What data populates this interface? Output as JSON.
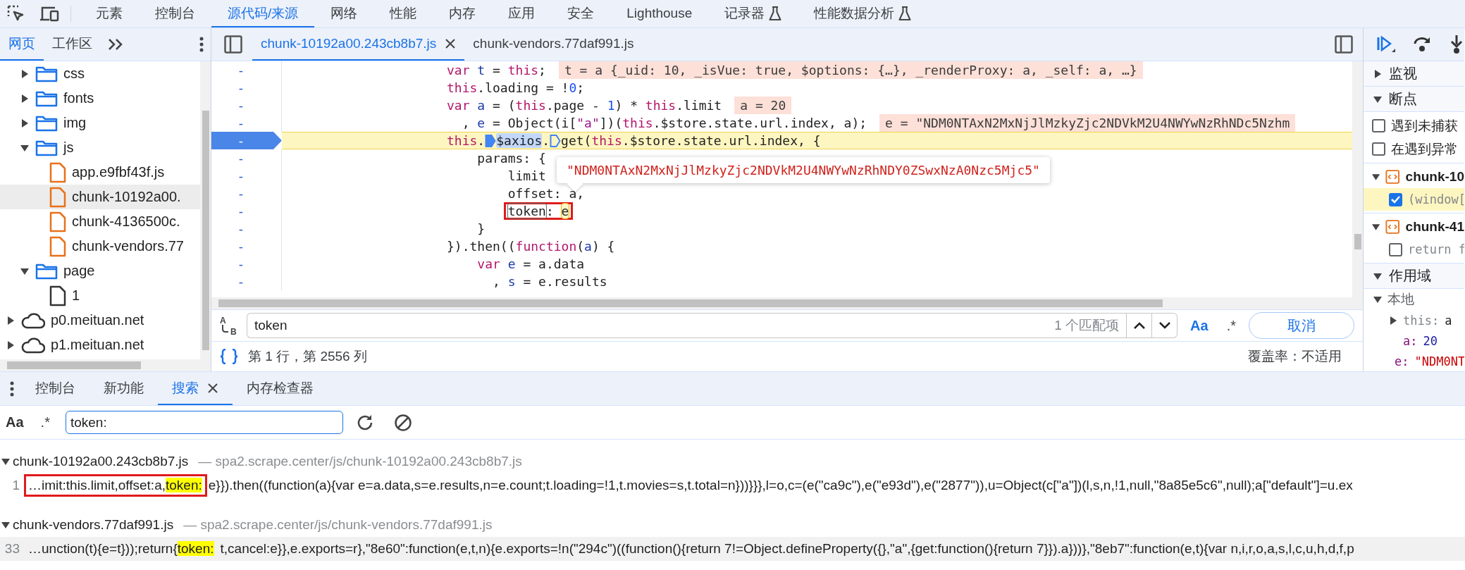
{
  "main_tabs": [
    {
      "label": "元素",
      "selected": false,
      "experimental": false
    },
    {
      "label": "控制台",
      "selected": false,
      "experimental": false
    },
    {
      "label": "源代码/来源",
      "selected": true,
      "experimental": false
    },
    {
      "label": "网络",
      "selected": false,
      "experimental": false
    },
    {
      "label": "性能",
      "selected": false,
      "experimental": false
    },
    {
      "label": "内存",
      "selected": false,
      "experimental": false
    },
    {
      "label": "应用",
      "selected": false,
      "experimental": false
    },
    {
      "label": "安全",
      "selected": false,
      "experimental": false
    },
    {
      "label": "Lighthouse",
      "selected": false,
      "experimental": false
    },
    {
      "label": "记录器",
      "selected": false,
      "experimental": true
    },
    {
      "label": "性能数据分析",
      "selected": false,
      "experimental": true
    }
  ],
  "navigator": {
    "tabs": [
      {
        "label": "网页",
        "selected": true
      },
      {
        "label": "工作区",
        "selected": false
      }
    ],
    "tree": {
      "nested": [
        {
          "label": "css",
          "kind": "folder",
          "expanded": false,
          "selected": false
        },
        {
          "label": "fonts",
          "kind": "folder",
          "expanded": false,
          "selected": false
        },
        {
          "label": "img",
          "kind": "folder",
          "expanded": false,
          "selected": false
        },
        {
          "label": "js",
          "kind": "folder",
          "expanded": true,
          "selected": false,
          "children": [
            {
              "label": "app.e9fbf43f.js",
              "kind": "script",
              "selected": false
            },
            {
              "label": "chunk-10192a00.",
              "kind": "script",
              "selected": true
            },
            {
              "label": "chunk-4136500c.",
              "kind": "script",
              "selected": false
            },
            {
              "label": "chunk-vendors.77",
              "kind": "script",
              "selected": false
            }
          ]
        },
        {
          "label": "page",
          "kind": "folder",
          "expanded": true,
          "selected": false,
          "children": [
            {
              "label": "1",
              "kind": "document",
              "selected": false
            }
          ]
        }
      ],
      "roots": [
        {
          "label": "p0.meituan.net",
          "kind": "domain",
          "expanded": false,
          "selected": false
        },
        {
          "label": "p1.meituan.net",
          "kind": "domain",
          "expanded": false,
          "selected": false
        }
      ]
    }
  },
  "editor": {
    "tabs": [
      {
        "label": "chunk-10192a00.243cb8b7.js",
        "selected": true,
        "closable": true
      },
      {
        "label": "chunk-vendors.77daf991.js",
        "selected": false,
        "closable": false
      }
    ],
    "lines": [
      {
        "gutter": "-",
        "current": false,
        "tokens": [
          {
            "kind": "kw",
            "text": "var"
          },
          {
            "kind": "def",
            "text": " t"
          },
          {
            "kind": "plain",
            "text": " = "
          },
          {
            "kind": "kw",
            "text": "this"
          },
          {
            "kind": "plain",
            "text": ";"
          },
          {
            "kind": "inline",
            "text": "t = a {_uid: 10, _isVue: true, $options: {…}, _renderProxy: a, _self: a, …}"
          }
        ]
      },
      {
        "gutter": "-",
        "current": false,
        "tokens": [
          {
            "kind": "kw",
            "text": "this"
          },
          {
            "kind": "plain",
            "text": ".loading = !"
          },
          {
            "kind": "num",
            "text": "0"
          },
          {
            "kind": "plain",
            "text": ";"
          }
        ]
      },
      {
        "gutter": "-",
        "current": false,
        "tokens": [
          {
            "kind": "kw",
            "text": "var"
          },
          {
            "kind": "def",
            "text": " a"
          },
          {
            "kind": "plain",
            "text": " = ("
          },
          {
            "kind": "kw",
            "text": "this"
          },
          {
            "kind": "plain",
            "text": ".page - "
          },
          {
            "kind": "num",
            "text": "1"
          },
          {
            "kind": "plain",
            "text": ") * "
          },
          {
            "kind": "kw",
            "text": "this"
          },
          {
            "kind": "plain",
            "text": ".limit"
          },
          {
            "kind": "inline",
            "text": "a = 20"
          }
        ]
      },
      {
        "gutter": "-",
        "current": false,
        "tokens": [
          {
            "kind": "plain",
            "text": "  , "
          },
          {
            "kind": "def",
            "text": "e"
          },
          {
            "kind": "plain",
            "text": " = Object(i["
          },
          {
            "kind": "str",
            "text": "\"a\""
          },
          {
            "kind": "plain",
            "text": "])("
          },
          {
            "kind": "kw",
            "text": "this"
          },
          {
            "kind": "plain",
            "text": ".$store.state.url.index, a);"
          },
          {
            "kind": "inline",
            "text": "e = \"NDM0NTAxN2MxNjJlMzkyZjc2NDVkM2U4NWYwNzRhNDc5Nzhm"
          }
        ]
      },
      {
        "gutter": "-",
        "current": true,
        "tokens": [
          {
            "kind": "kw",
            "text": "this"
          },
          {
            "kind": "plain",
            "text": "."
          },
          {
            "kind": "bp",
            "on": true
          },
          {
            "kind": "sel",
            "text": "$axios"
          },
          {
            "kind": "plain",
            "text": "."
          },
          {
            "kind": "bp",
            "on": false
          },
          {
            "kind": "plain",
            "text": "get("
          },
          {
            "kind": "kw",
            "text": "this"
          },
          {
            "kind": "plain",
            "text": ".$store.state.url.index, {"
          }
        ],
        "children": [
          {
            "gutter": "-",
            "current": false,
            "tokens": [
              {
                "kind": "plain",
                "text": "params: {"
              }
            ],
            "children": [
              {
                "gutter": "-",
                "current": false,
                "tokens": [
                  {
                    "kind": "plain",
                    "text": "limit"
                  }
                ]
              },
              {
                "gutter": "-",
                "current": false,
                "tokens": [
                  {
                    "kind": "plain",
                    "text": "offset: a,"
                  }
                ]
              },
              {
                "gutter": "-",
                "current": false,
                "tokens": [
                  {
                    "kind": "match",
                    "text": "token",
                    "annotated": true
                  },
                  {
                    "kind": "plain",
                    "text": ": ",
                    "annotated": true
                  },
                  {
                    "kind": "cursor",
                    "text": "e",
                    "annotated": true
                  }
                ]
              }
            ]
          },
          {
            "gutter": "-",
            "current": false,
            "tokens": [
              {
                "kind": "plain",
                "text": "}"
              }
            ]
          }
        ]
      },
      {
        "gutter": "-",
        "current": false,
        "tokens": [
          {
            "kind": "plain",
            "text": "}).then(("
          },
          {
            "kind": "kw",
            "text": "function"
          },
          {
            "kind": "plain",
            "text": "("
          },
          {
            "kind": "def",
            "text": "a"
          },
          {
            "kind": "plain",
            "text": ") {"
          }
        ],
        "children": [
          {
            "gutter": "-",
            "current": false,
            "tokens": [
              {
                "kind": "kw",
                "text": "var"
              },
              {
                "kind": "def",
                "text": " e"
              },
              {
                "kind": "plain",
                "text": " = a.data"
              }
            ]
          },
          {
            "gutter": "-",
            "current": false,
            "tokens": [
              {
                "kind": "plain",
                "text": "  , "
              },
              {
                "kind": "def",
                "text": "s"
              },
              {
                "kind": "plain",
                "text": " = e.results"
              }
            ]
          }
        ]
      }
    ],
    "popover": {
      "text": "\"NDM0NTAxN2MxNjJlMzkyZjc2NDVkM2U4NWYwNzRhNDY0ZSwxNzA0Nzc5Mjc5\""
    },
    "find": {
      "replace": {
        "top": "A",
        "bottom": "B"
      },
      "query": "token",
      "count": "1 个匹配项",
      "case_label": "Aa",
      "case_sensitive": true,
      "regex_label": ".*",
      "cancel": "取消"
    },
    "status": {
      "position": "第 1 行，第 2556 列",
      "coverage": "覆盖率：不适用"
    }
  },
  "debugger": {
    "watch": {
      "title": "监视",
      "expanded": false
    },
    "breakpoints": {
      "title": "断点",
      "expanded": true,
      "options": [
        {
          "label": "遇到未捕获",
          "checked": false
        },
        {
          "label": "在遇到异常",
          "checked": false
        }
      ],
      "files": [
        {
          "name": "chunk-10",
          "expanded": true,
          "items": [
            {
              "code": "(window[",
              "checked": true,
              "selected": true
            }
          ]
        },
        {
          "name": "chunk-41",
          "expanded": true,
          "items": [
            {
              "code": "return f",
              "checked": false,
              "selected": false
            }
          ]
        }
      ]
    },
    "scope": {
      "title": "作用域",
      "expanded": true,
      "groups": [
        {
          "title": "本地",
          "expanded": true,
          "vars": [
            {
              "name": "this:",
              "value": "a",
              "kind": "object",
              "expanded": false
            },
            {
              "name": "a:",
              "value": "20",
              "kind": "number"
            },
            {
              "name": "e:",
              "value": "\"NDM0NT",
              "kind": "string"
            }
          ]
        }
      ]
    }
  },
  "drawer": {
    "tabs": [
      {
        "label": "控制台",
        "selected": false,
        "closable": false
      },
      {
        "label": "新功能",
        "selected": false,
        "closable": false
      },
      {
        "label": "搜索",
        "selected": true,
        "closable": true
      },
      {
        "label": "内存检查器",
        "selected": false,
        "closable": false
      }
    ],
    "search": {
      "case_label": "Aa",
      "case_sensitive": false,
      "regex_label": ".*",
      "value": "token:"
    },
    "results": [
      {
        "file": "chunk-10192a00.243cb8b7.js",
        "separator": "—",
        "path": "spa2.scrape.center/js/chunk-10192a00.243cb8b7.js",
        "expanded": true,
        "matches": [
          {
            "line": "1",
            "prefix": "…imit:this.limit,offset:a,",
            "match": "token:",
            "suffix": "e}}).then((function(a){var e=a.data,s=e.results,n=e.count;t.loading=!1,t.movies=s,t.total=n}))}}},l=o,c=(e(\"ca9c\"),e(\"e93d\"),e(\"2877\")),u=Object(c[\"a\"])(l,s,n,!1,null,\"8a85e5c6\",null);a[\"default\"]=u.ex",
            "annotated": true,
            "hovered": false
          }
        ]
      },
      {
        "file": "chunk-vendors.77daf991.js",
        "separator": "—",
        "path": "spa2.scrape.center/js/chunk-vendors.77daf991.js",
        "expanded": true,
        "matches": [
          {
            "line": "33",
            "prefix": "…unction(t){e=t}));return{",
            "match": "token:",
            "suffix": "t,cancel:e}},e.exports=r},\"8e60\":function(e,t,n){e.exports=!n(\"294c\")((function(){return 7!=Object.defineProperty({},\"a\",{get:function(){return 7}}).a}))},\"8eb7\":function(e,t){var n,i,r,o,a,s,l,c,u,h,d,f,p",
            "annotated": false,
            "hovered": true
          }
        ]
      }
    ]
  }
}
